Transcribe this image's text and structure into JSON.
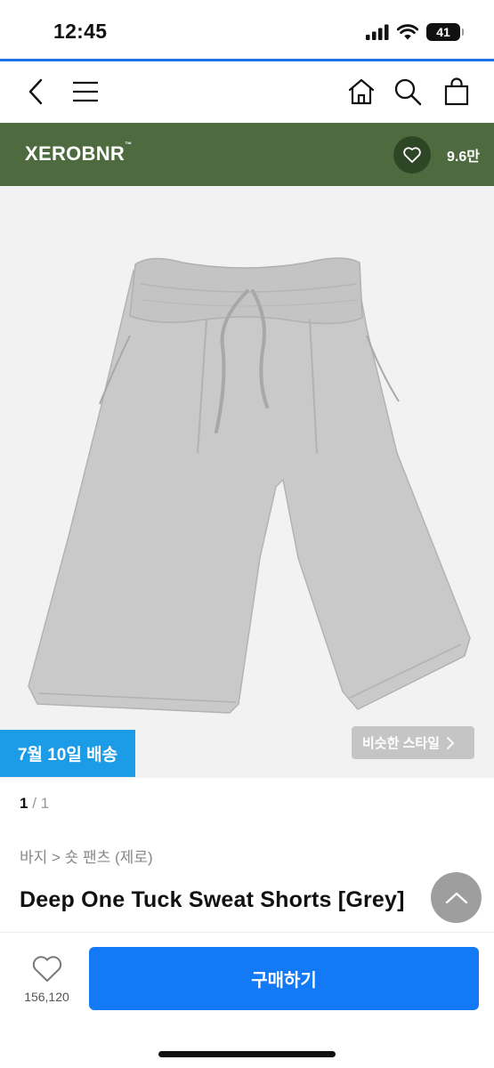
{
  "status_bar": {
    "time": "12:45",
    "battery": "41",
    "icons": [
      "cellular-signal-icon",
      "wifi-icon",
      "battery-icon"
    ]
  },
  "nav": {
    "icons": [
      "back-chevron-icon",
      "hamburger-menu-icon",
      "home-icon",
      "search-icon",
      "shopping-bag-icon"
    ]
  },
  "brand": {
    "name": "XEROBNR",
    "trademark": "™",
    "like_count": "9.6만",
    "background_color": "#4d6b3f"
  },
  "product": {
    "image": "grey-sweat-shorts",
    "delivery_badge": "7월 10일 배송",
    "similar_style_label": "비슷한 스타일",
    "page_current": "1",
    "page_separator": "/",
    "page_total": "1",
    "breadcrumb": "바지 > 숏 팬츠 (제로)",
    "title": "Deep One Tuck Sweat Shorts [Grey]"
  },
  "bottom_bar": {
    "like_count": "156,120",
    "buy_label": "구매하기",
    "accent_color": "#1479f5"
  }
}
